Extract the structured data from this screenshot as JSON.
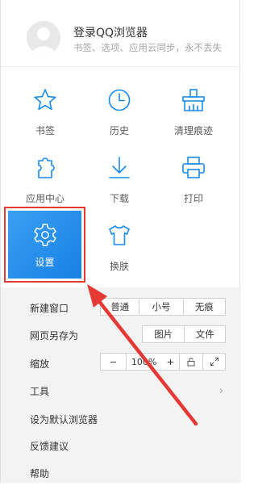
{
  "account": {
    "title": "登录QQ浏览器",
    "subtitle": "书签、选项、应用云同步，永不丢失"
  },
  "grid": {
    "bookmarks": "书签",
    "history": "历史",
    "clear": "清理痕迹",
    "apps": "应用中心",
    "download": "下载",
    "print": "打印",
    "settings": "设置",
    "skin": "换肤"
  },
  "menu": {
    "new_window": "新建窗口",
    "new_window_opts": [
      "普通",
      "小号",
      "无痕"
    ],
    "save_as": "网页另存为",
    "save_as_opts": [
      "图片",
      "文件"
    ],
    "zoom": "缩放",
    "zoom_minus": "−",
    "zoom_value": "100%",
    "zoom_plus": "+",
    "tools": "工具",
    "tools_arrow": "›",
    "default_browser": "设为默认浏览器",
    "feedback": "反馈建议",
    "help": "帮助"
  },
  "colors": {
    "accent": "#1a8ae8",
    "highlight_box": "#e53935",
    "arrow": "#e53935"
  }
}
